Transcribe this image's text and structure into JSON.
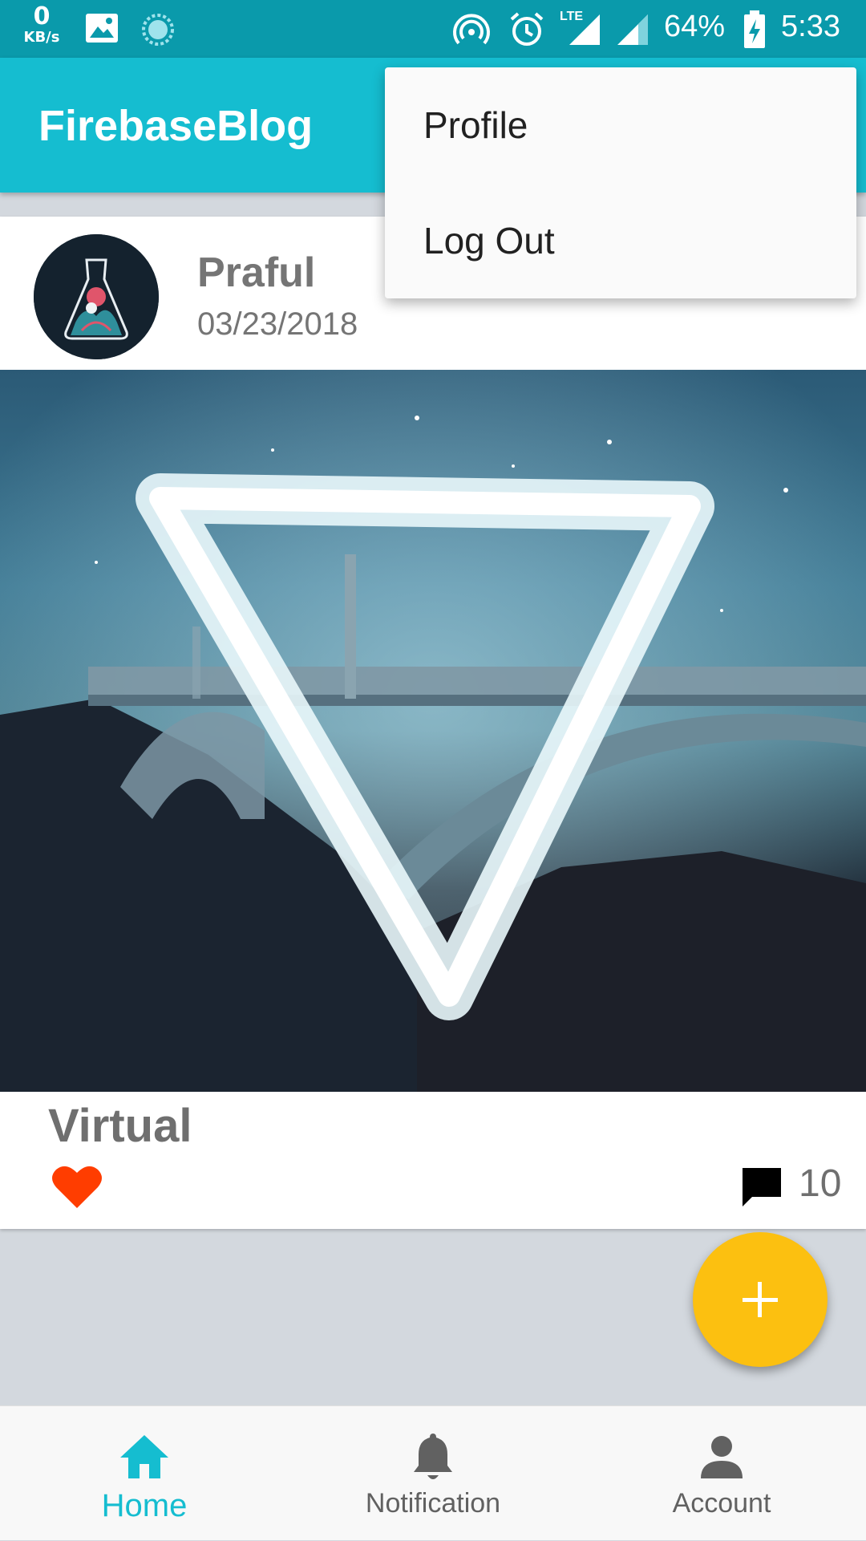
{
  "status_bar": {
    "net_speed": "0",
    "net_unit": "KB/s",
    "network_type": "LTE",
    "battery": "64%",
    "time": "5:33"
  },
  "app_bar": {
    "title": "FirebaseBlog"
  },
  "overflow_menu": {
    "items": [
      {
        "label": "Profile"
      },
      {
        "label": "Log Out"
      }
    ]
  },
  "post": {
    "author": "Praful",
    "date": "03/23/2018",
    "title": "Virtual",
    "comment_count": "10"
  },
  "bottom_nav": {
    "items": [
      {
        "label": "Home",
        "icon": "home-icon",
        "active": true
      },
      {
        "label": "Notification",
        "icon": "bell-icon",
        "active": false
      },
      {
        "label": "Account",
        "icon": "person-icon",
        "active": false
      }
    ]
  },
  "colors": {
    "primary": "#15bdd0",
    "primary_dark": "#0a9aab",
    "accent": "#fcc010",
    "like": "#ff3d00",
    "nav_active": "#15bdd0",
    "nav_inactive": "#616161"
  }
}
